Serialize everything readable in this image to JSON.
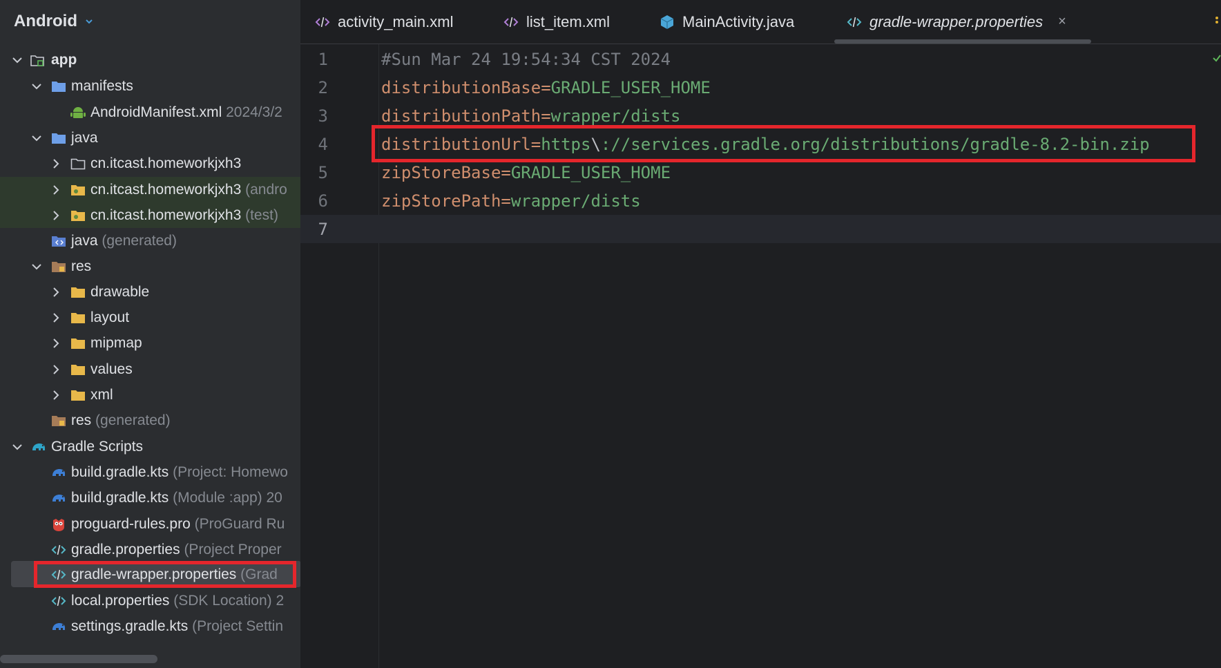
{
  "sidebar": {
    "view_selector": "Android",
    "rows": [
      {
        "name": "app",
        "hint": ""
      },
      {
        "name": "manifests",
        "hint": ""
      },
      {
        "name": "AndroidManifest.xml",
        "hint": "2024/3/2"
      },
      {
        "name": "java",
        "hint": ""
      },
      {
        "name": "cn.itcast.homeworkjxh3",
        "hint": ""
      },
      {
        "name": "cn.itcast.homeworkjxh3",
        "hint": "(andro"
      },
      {
        "name": "cn.itcast.homeworkjxh3",
        "hint": "(test)"
      },
      {
        "name": "java",
        "hint": "(generated)"
      },
      {
        "name": "res",
        "hint": ""
      },
      {
        "name": "drawable",
        "hint": ""
      },
      {
        "name": "layout",
        "hint": ""
      },
      {
        "name": "mipmap",
        "hint": ""
      },
      {
        "name": "values",
        "hint": ""
      },
      {
        "name": "xml",
        "hint": ""
      },
      {
        "name": "res",
        "hint": "(generated)"
      },
      {
        "name": "Gradle Scripts",
        "hint": ""
      },
      {
        "name": "build.gradle.kts",
        "hint": "(Project: Homewo"
      },
      {
        "name": "build.gradle.kts",
        "hint": "(Module :app)  20"
      },
      {
        "name": "proguard-rules.pro",
        "hint": "(ProGuard Ru"
      },
      {
        "name": "gradle.properties",
        "hint": "(Project Proper"
      },
      {
        "name": "gradle-wrapper.properties",
        "hint": "(Grad"
      },
      {
        "name": "local.properties",
        "hint": "(SDK Location)  2"
      },
      {
        "name": "settings.gradle.kts",
        "hint": "(Project Settin"
      }
    ]
  },
  "tabs": [
    {
      "label": "activity_main.xml",
      "icon": "xml-code-icon"
    },
    {
      "label": "list_item.xml",
      "icon": "xml-code-icon"
    },
    {
      "label": "MainActivity.java",
      "icon": "java-class-icon"
    },
    {
      "label": "gradle-wrapper.properties",
      "icon": "properties-code-icon",
      "active": true,
      "close": "×"
    }
  ],
  "editor": {
    "line_numbers": [
      "1",
      "2",
      "3",
      "4",
      "5",
      "6",
      "7"
    ],
    "lines": [
      {
        "comment": "#Sun Mar 24 19:54:34 CST 2024"
      },
      {
        "key": "distributionBase",
        "eq": "=",
        "val": "GRADLE_USER_HOME"
      },
      {
        "key": "distributionPath",
        "eq": "=",
        "val": "wrapper/dists"
      },
      {
        "key": "distributionUrl",
        "eq": "=",
        "val_pre": "https",
        "esc": "\\",
        "val_post": "://services.gradle.org/distributions/gradle-8.2-bin.zip"
      },
      {
        "key": "zipStoreBase",
        "eq": "=",
        "val": "GRADLE_USER_HOME"
      },
      {
        "key": "zipStorePath",
        "eq": "=",
        "val": "wrapper/dists"
      }
    ]
  },
  "colors": {
    "highlight_red": "#e5262c",
    "key_orange": "#cf8e6d",
    "value_green": "#6aab73",
    "comment_gray": "#7a7e85"
  }
}
